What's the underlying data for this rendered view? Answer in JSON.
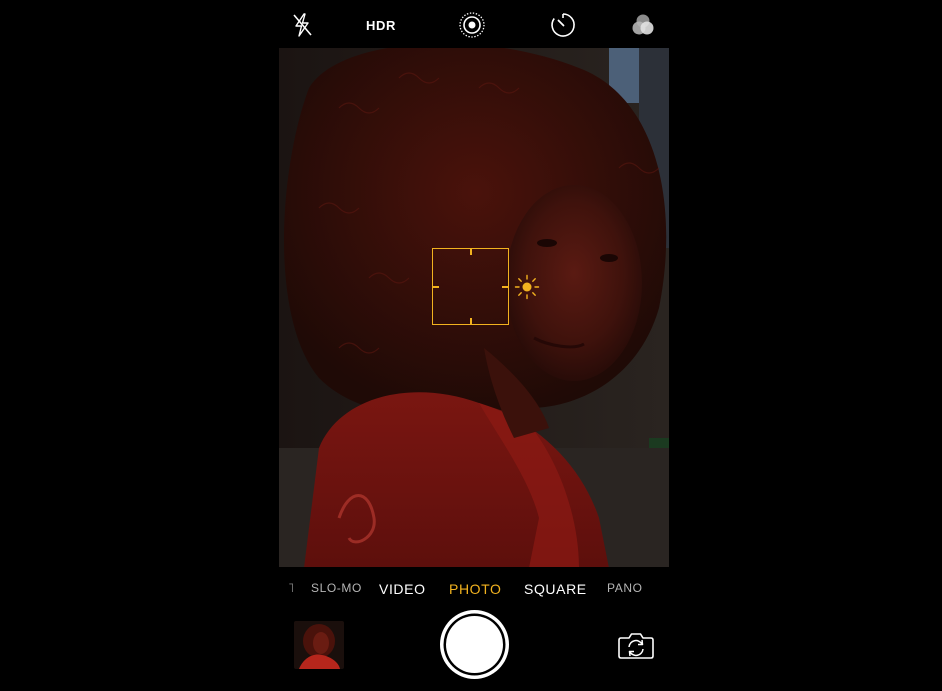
{
  "topbar": {
    "flash_icon": "flash-off-icon",
    "hdr_label": "HDR",
    "live_photo_icon": "live-photo-icon",
    "timer_icon": "timer-icon",
    "filters_icon": "filters-icon"
  },
  "viewfinder": {
    "focus_icon": "focus-square",
    "exposure_icon": "sun-icon"
  },
  "modes": {
    "items": [
      "SLO-MO",
      "VIDEO",
      "PHOTO",
      "SQUARE",
      "PANO"
    ],
    "selected": "PHOTO"
  },
  "bottom": {
    "thumbnail_icon": "last-photo-thumbnail",
    "shutter_icon": "shutter-icon",
    "flip_icon": "camera-flip-icon"
  },
  "colors": {
    "accent": "#f2b21f",
    "background": "#000000",
    "text": "#ffffff"
  }
}
